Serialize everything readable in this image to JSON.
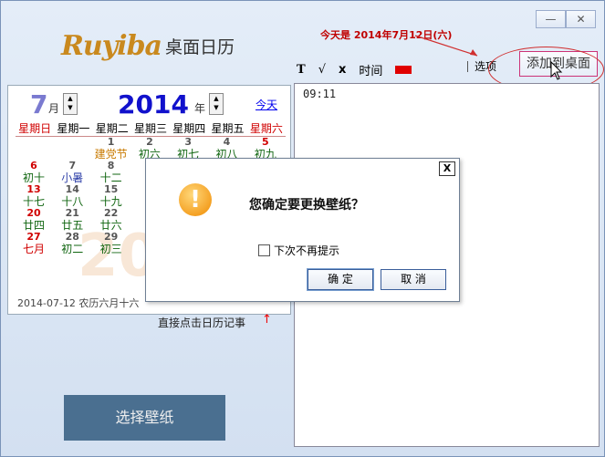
{
  "window": {
    "minimize": "—",
    "close": "✕"
  },
  "logo": {
    "mark": "Ruyiba",
    "text": "桌面日历"
  },
  "today_banner": "今天是 2014年7月12日(六)",
  "toolbar": {
    "items": [
      {
        "name": "font-icon",
        "label": "T"
      },
      {
        "name": "check-icon",
        "label": "√"
      },
      {
        "name": "clear-icon",
        "label": "x"
      },
      {
        "name": "time-label",
        "label": "时间"
      }
    ],
    "color": "#e00000"
  },
  "options_label": "选项",
  "add_to_desktop_label": "添加到桌面",
  "calendar": {
    "month": "7",
    "month_unit": "月",
    "year": "2014",
    "year_unit": "年",
    "today_link": "今天",
    "weekdays": [
      "星期日",
      "星期一",
      "星期二",
      "星期三",
      "星期四",
      "星期五",
      "星期六"
    ],
    "watermark": "2014",
    "days": [
      {
        "d": "1",
        "l": "建党节",
        "col": 2,
        "row": 0,
        "lc": "#c87a00"
      },
      {
        "d": "2",
        "l": "初六",
        "col": 3,
        "row": 0
      },
      {
        "d": "3",
        "l": "初七",
        "col": 4,
        "row": 0
      },
      {
        "d": "4",
        "l": "初八",
        "col": 5,
        "row": 0
      },
      {
        "d": "5",
        "l": "初九",
        "col": 6,
        "row": 0,
        "dc": "#d00000"
      },
      {
        "d": "6",
        "l": "初十",
        "col": 0,
        "row": 1,
        "dc": "#d00000"
      },
      {
        "d": "7",
        "l": "小暑",
        "col": 1,
        "row": 1,
        "lc": "#3344aa"
      },
      {
        "d": "8",
        "l": "十二",
        "col": 2,
        "row": 1
      },
      {
        "d": "13",
        "l": "十七",
        "col": 0,
        "row": 2,
        "dc": "#d00000"
      },
      {
        "d": "14",
        "l": "十八",
        "col": 1,
        "row": 2
      },
      {
        "d": "15",
        "l": "十九",
        "col": 2,
        "row": 2
      },
      {
        "d": "20",
        "l": "廿四",
        "col": 0,
        "row": 3,
        "dc": "#d00000"
      },
      {
        "d": "21",
        "l": "廿五",
        "col": 1,
        "row": 3
      },
      {
        "d": "22",
        "l": "廿六",
        "col": 2,
        "row": 3
      },
      {
        "d": "27",
        "l": "七月",
        "col": 0,
        "row": 4,
        "dc": "#d00000",
        "lc": "#d00000"
      },
      {
        "d": "28",
        "l": "初二",
        "col": 1,
        "row": 4
      },
      {
        "d": "29",
        "l": "初三",
        "col": 2,
        "row": 4
      }
    ],
    "footer": "2014-07-12 农历六月十六"
  },
  "hint": "直接点击日历记事",
  "choose_wallpaper": "选择壁纸",
  "note_text": "09:11",
  "dialog": {
    "close": "X",
    "message": "您确定要更换壁纸？",
    "dont_show": "下次不再提示",
    "ok": "确 定",
    "cancel": "取 消"
  }
}
